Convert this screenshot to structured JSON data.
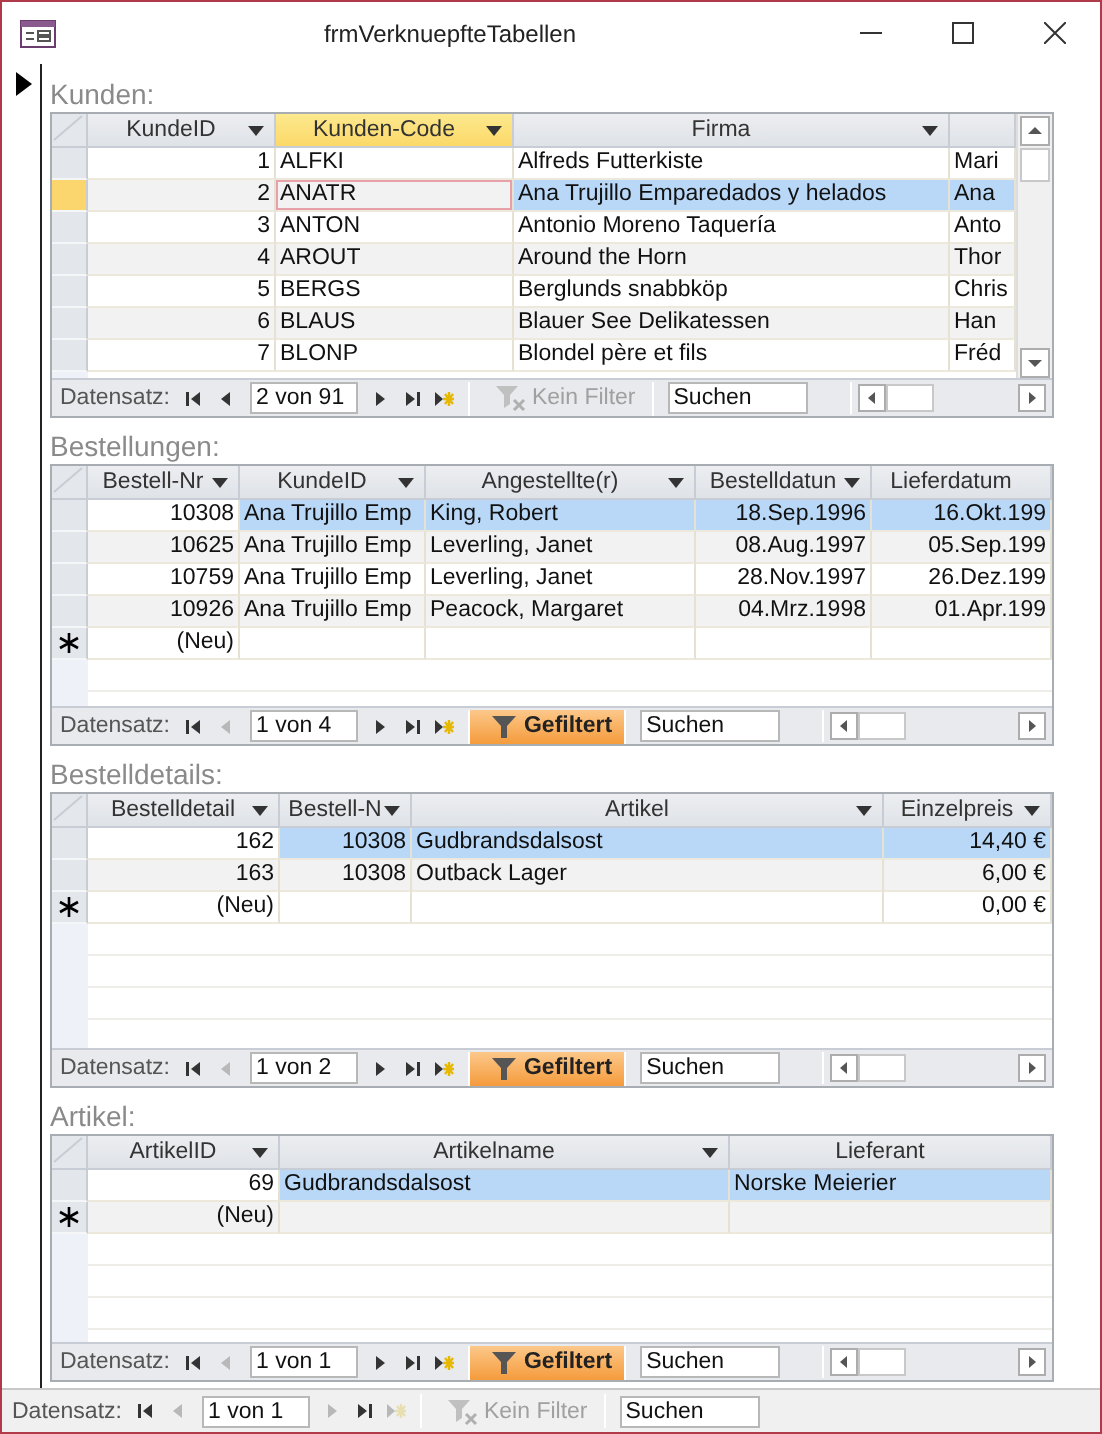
{
  "window": {
    "title": "frmVerknuepfteTabellen"
  },
  "subforms": [
    {
      "label": "Kunden:",
      "vertical_scrollbar": true,
      "columns": [
        {
          "label": "KundeID",
          "dropdown": true,
          "selected": false,
          "kind": "number"
        },
        {
          "label": "Kunden-Code",
          "dropdown": true,
          "selected": true,
          "kind": "text"
        },
        {
          "label": "Firma",
          "dropdown": true,
          "selected": false,
          "kind": "text"
        },
        {
          "dropdown": false,
          "selected": false,
          "kind": "text"
        }
      ],
      "rows": [
        {
          "kind": "data",
          "current": false,
          "cells": [
            "1",
            "ALFKI",
            "Alfreds Futterkiste",
            "Mari"
          ]
        },
        {
          "kind": "data",
          "current": true,
          "cells": [
            "2",
            "ANATR",
            "Ana Trujillo Emparedados y helados",
            "Ana"
          ],
          "highlighted": [
            false,
            false,
            true,
            true
          ]
        },
        {
          "kind": "data",
          "current": false,
          "cells": [
            "3",
            "ANTON",
            "Antonio Moreno Taquería",
            "Anto"
          ]
        },
        {
          "kind": "data",
          "current": false,
          "cells": [
            "4",
            "AROUT",
            "Around the Horn",
            "Thor"
          ]
        },
        {
          "kind": "data",
          "current": false,
          "cells": [
            "5",
            "BERGS",
            "Berglunds snabbköp",
            "Chris"
          ]
        },
        {
          "kind": "data",
          "current": false,
          "cells": [
            "6",
            "BLAUS",
            "Blauer See Delikatessen",
            "Han"
          ]
        },
        {
          "kind": "data",
          "current": false,
          "cells": [
            "7",
            "BLONP",
            "Blondel père et fils",
            "Fréd"
          ]
        }
      ],
      "nav": {
        "label": "Datensatz:",
        "position": "2 von 91",
        "buttons": [
          {
            "kind": "first",
            "disabled": false
          },
          {
            "kind": "prev",
            "disabled": false
          },
          {
            "kind": "next",
            "disabled": false
          },
          {
            "kind": "last",
            "disabled": false
          },
          {
            "kind": "new",
            "disabled": false
          }
        ],
        "filter": {
          "label": "Kein Filter",
          "active": false
        },
        "search": {
          "placeholder": "Suchen"
        },
        "horizontal_scrollbar": true
      }
    },
    {
      "label": "Bestellungen:",
      "vertical_scrollbar": false,
      "columns": [
        {
          "label": "Bestell-Nr",
          "dropdown": true,
          "selected": false,
          "kind": "number"
        },
        {
          "label": "KundeID",
          "dropdown": true,
          "selected": false,
          "kind": "text"
        },
        {
          "label": "Angestellte(r)",
          "dropdown": true,
          "selected": false,
          "kind": "text"
        },
        {
          "label": "Bestelldatun",
          "dropdown": true,
          "selected": false,
          "kind": "number"
        },
        {
          "label": "Lieferdatum",
          "dropdown": false,
          "selected": false,
          "kind": "number"
        }
      ],
      "rows": [
        {
          "kind": "data",
          "current": false,
          "cells": [
            "10308",
            "Ana Trujillo Emp",
            "King, Robert",
            "18.Sep.1996",
            "16.Okt.199"
          ],
          "highlighted": [
            false,
            true,
            true,
            true,
            true
          ]
        },
        {
          "kind": "data",
          "current": false,
          "cells": [
            "10625",
            "Ana Trujillo Emp",
            "Leverling, Janet",
            "08.Aug.1997",
            "05.Sep.199"
          ]
        },
        {
          "kind": "data",
          "current": false,
          "cells": [
            "10759",
            "Ana Trujillo Emp",
            "Leverling, Janet",
            "28.Nov.1997",
            "26.Dez.199"
          ]
        },
        {
          "kind": "data",
          "current": false,
          "cells": [
            "10926",
            "Ana Trujillo Emp",
            "Peacock, Margaret",
            "04.Mrz.1998",
            "01.Apr.199"
          ]
        },
        {
          "kind": "new",
          "current": false,
          "cells": [
            "(Neu)",
            null,
            null,
            null,
            null
          ]
        }
      ],
      "nav": {
        "label": "Datensatz:",
        "position": "1 von 4",
        "buttons": [
          {
            "kind": "first",
            "disabled": false
          },
          {
            "kind": "prev",
            "disabled": true
          },
          {
            "kind": "next",
            "disabled": false
          },
          {
            "kind": "last",
            "disabled": false
          },
          {
            "kind": "new",
            "disabled": false
          }
        ],
        "filter": {
          "label": "Gefiltert",
          "active": true
        },
        "search": {
          "placeholder": "Suchen"
        },
        "horizontal_scrollbar": true
      }
    },
    {
      "label": "Bestelldetails:",
      "vertical_scrollbar": false,
      "columns": [
        {
          "label": "Bestelldetail",
          "dropdown": true,
          "selected": false,
          "kind": "number"
        },
        {
          "label": "Bestell-N",
          "dropdown": true,
          "selected": false,
          "kind": "number"
        },
        {
          "label": "Artikel",
          "dropdown": true,
          "selected": false,
          "kind": "text"
        },
        {
          "label": "Einzelpreis",
          "dropdown": true,
          "selected": false,
          "kind": "number"
        }
      ],
      "rows": [
        {
          "kind": "data",
          "current": false,
          "cells": [
            "162",
            "10308",
            "Gudbrandsdalsost",
            "14,40 €"
          ],
          "highlighted": [
            false,
            true,
            true,
            true
          ]
        },
        {
          "kind": "data",
          "current": false,
          "cells": [
            "163",
            "10308",
            "Outback Lager",
            "6,00 €"
          ]
        },
        {
          "kind": "new",
          "current": false,
          "cells": [
            "(Neu)",
            null,
            null,
            "0,00 €"
          ]
        }
      ],
      "nav": {
        "label": "Datensatz:",
        "position": "1 von 2",
        "buttons": [
          {
            "kind": "first",
            "disabled": false
          },
          {
            "kind": "prev",
            "disabled": true
          },
          {
            "kind": "next",
            "disabled": false
          },
          {
            "kind": "last",
            "disabled": false
          },
          {
            "kind": "new",
            "disabled": false
          }
        ],
        "filter": {
          "label": "Gefiltert",
          "active": true
        },
        "search": {
          "placeholder": "Suchen"
        },
        "horizontal_scrollbar": true
      }
    },
    {
      "label": "Artikel:",
      "vertical_scrollbar": false,
      "columns": [
        {
          "label": "ArtikelID",
          "dropdown": true,
          "selected": false,
          "kind": "number"
        },
        {
          "label": "Artikelname",
          "dropdown": true,
          "selected": false,
          "kind": "text"
        },
        {
          "label": "Lieferant",
          "dropdown": false,
          "selected": false,
          "kind": "text"
        }
      ],
      "rows": [
        {
          "kind": "data",
          "current": false,
          "cells": [
            "69",
            "Gudbrandsdalsost",
            "Norske Meierier"
          ],
          "highlighted": [
            false,
            true,
            true
          ]
        },
        {
          "kind": "new",
          "current": false,
          "cells": [
            "(Neu)",
            null,
            null
          ]
        }
      ],
      "nav": {
        "label": "Datensatz:",
        "position": "1 von 1",
        "buttons": [
          {
            "kind": "first",
            "disabled": false
          },
          {
            "kind": "prev",
            "disabled": true
          },
          {
            "kind": "next",
            "disabled": false
          },
          {
            "kind": "last",
            "disabled": false
          },
          {
            "kind": "new",
            "disabled": false
          }
        ],
        "filter": {
          "label": "Gefiltert",
          "active": true
        },
        "search": {
          "placeholder": "Suchen"
        },
        "horizontal_scrollbar": true
      }
    }
  ],
  "form_nav": {
    "label": "Datensatz:",
    "position": "1 von 1",
    "buttons": [
      {
        "kind": "first",
        "disabled": false
      },
      {
        "kind": "prev",
        "disabled": true
      },
      {
        "kind": "next",
        "disabled": true
      },
      {
        "kind": "last",
        "disabled": false
      },
      {
        "kind": "new",
        "disabled": true
      }
    ],
    "filter": {
      "label": "Kein Filter",
      "active": false
    },
    "search": {
      "placeholder": "Suchen"
    },
    "horizontal_scrollbar": false
  }
}
